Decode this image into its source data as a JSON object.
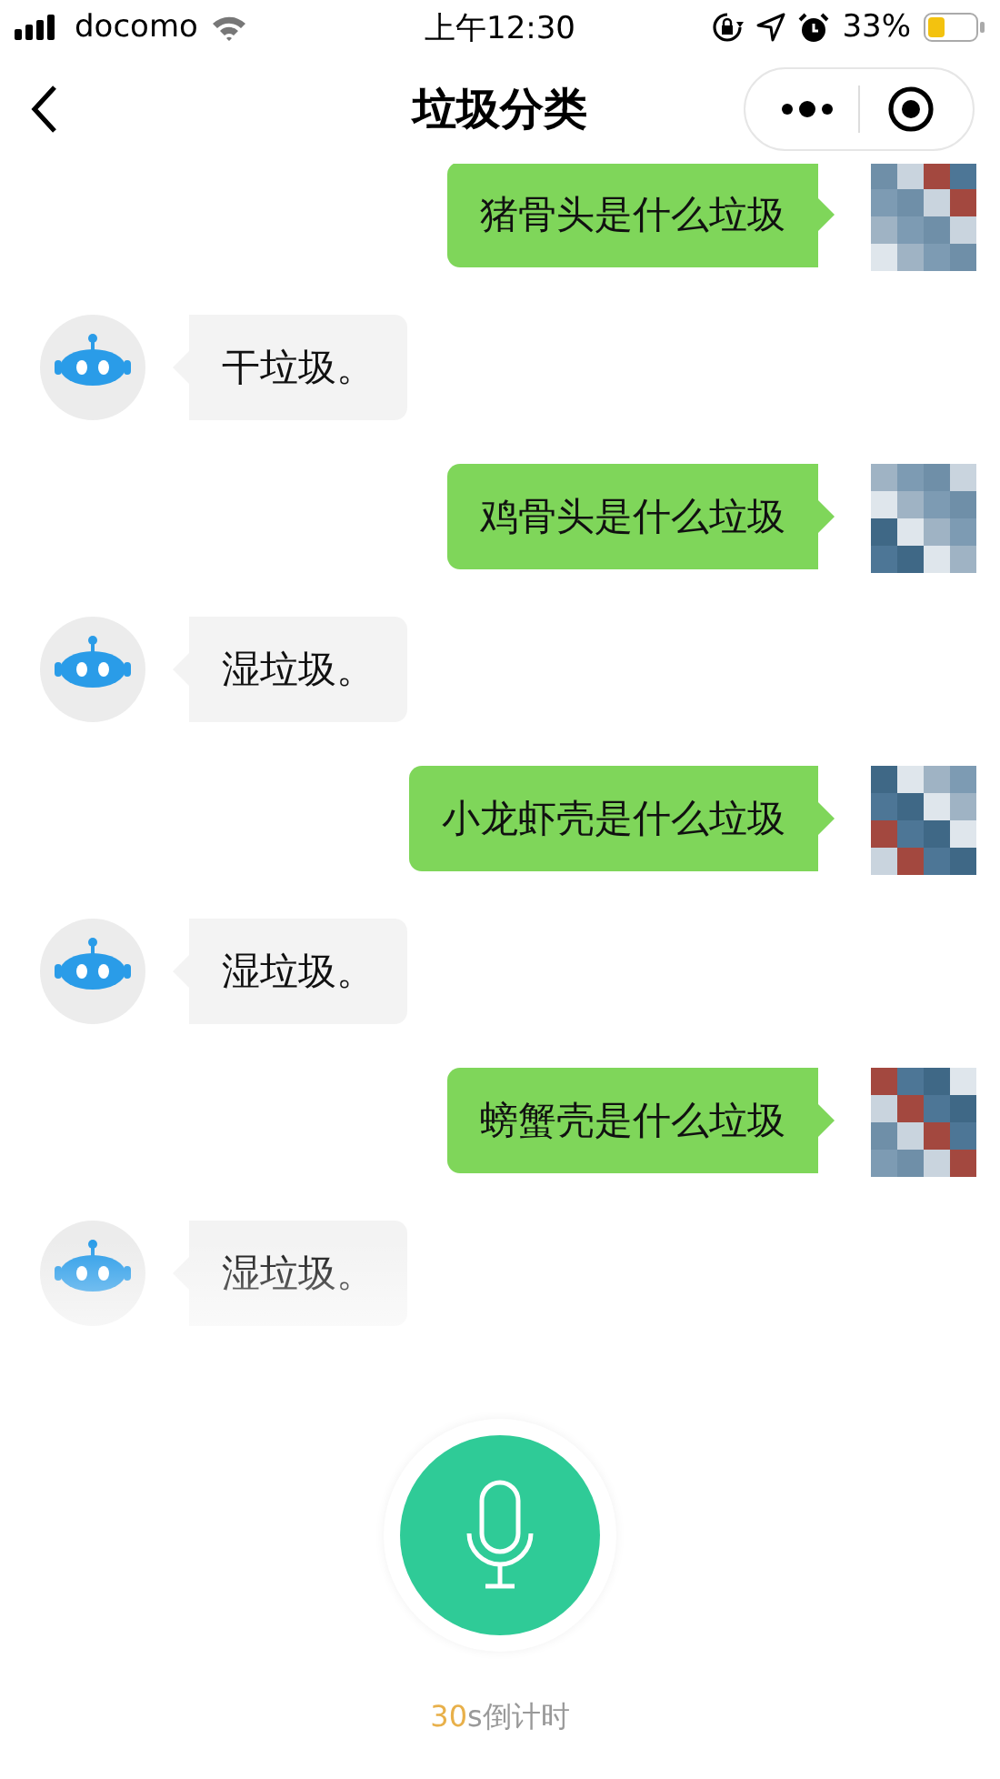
{
  "status_bar": {
    "carrier": "docomo",
    "time": "上午12:30",
    "battery": "33%"
  },
  "nav": {
    "title": "垃圾分类"
  },
  "messages": [
    {
      "kind": "user",
      "text": "猪骨头是什么垃圾"
    },
    {
      "kind": "bot",
      "text": "干垃圾。"
    },
    {
      "kind": "user",
      "text": "鸡骨头是什么垃圾"
    },
    {
      "kind": "bot",
      "text": "湿垃圾。"
    },
    {
      "kind": "user",
      "text": "小龙虾壳是什么垃圾"
    },
    {
      "kind": "bot",
      "text": "湿垃圾。"
    },
    {
      "kind": "user",
      "text": "螃蟹壳是什么垃圾"
    },
    {
      "kind": "bot",
      "text": "湿垃圾。"
    }
  ],
  "countdown": {
    "number": "30",
    "label": "s倒计时"
  }
}
